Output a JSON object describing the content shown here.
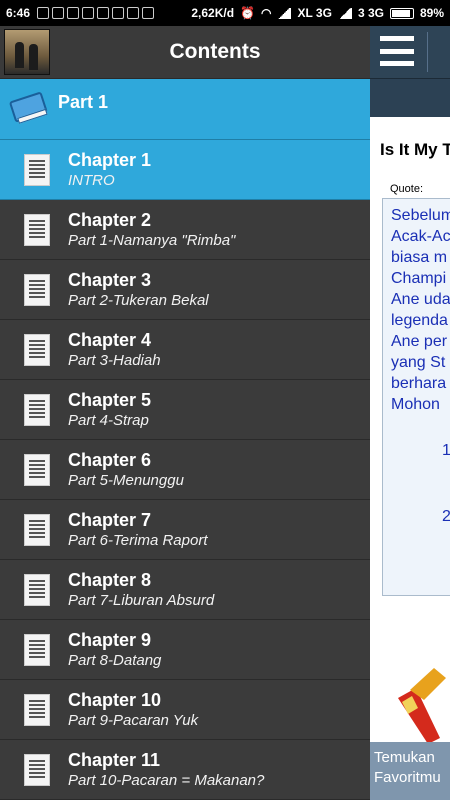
{
  "status_bar": {
    "time": "6:46",
    "speed": "2,62K/d",
    "network1": "XL 3G",
    "network2": "3 3G",
    "battery": "89%",
    "battery_level": 0.89,
    "icons": [
      "whatsapp-icon",
      "whatsapp-icon",
      "bbm-icon",
      "bbm-icon",
      "whatsapp-icon",
      "whatsapp-icon",
      "whatsapp-icon",
      "whatsapp-icon"
    ]
  },
  "drawer": {
    "title": "Contents",
    "part": {
      "label": "Part 1",
      "icon": "book-icon"
    },
    "chapters": [
      {
        "title": "Chapter 1",
        "subtitle": "INTRO",
        "active": true
      },
      {
        "title": "Chapter 2",
        "subtitle": "Part 1-Namanya \"Rimba\""
      },
      {
        "title": "Chapter 3",
        "subtitle": "Part 2-Tukeran Bekal"
      },
      {
        "title": "Chapter 4",
        "subtitle": "Part 3-Hadiah"
      },
      {
        "title": "Chapter 5",
        "subtitle": "Part 4-Strap"
      },
      {
        "title": "Chapter 6",
        "subtitle": "Part 5-Menunggu"
      },
      {
        "title": "Chapter 7",
        "subtitle": "Part 6-Terima Raport"
      },
      {
        "title": "Chapter 8",
        "subtitle": "Part 7-Liburan Absurd"
      },
      {
        "title": "Chapter 9",
        "subtitle": "Part 8-Datang"
      },
      {
        "title": "Chapter 10",
        "subtitle": "Part 9-Pacaran Yuk"
      },
      {
        "title": "Chapter 11",
        "subtitle": "Part 10-Pacaran = Makanan?"
      }
    ]
  },
  "content": {
    "article_title": "Is It My T",
    "quote_label": "Quote:",
    "quote_lines": [
      "Sebelum",
      "Acak-Ac",
      "biasa m",
      "Champi",
      "Ane uda",
      "legenda",
      "Ane per",
      "yang St",
      "berhara",
      "Mohon"
    ],
    "numbers": [
      "1",
      "2"
    ],
    "bottom_text": [
      "Temukan",
      "Favoritmu"
    ]
  },
  "colors": {
    "accent": "#2fa8db",
    "drawer_bg": "#3b3b3b",
    "toolbar": "#2e4456",
    "quote_text": "#1a2fb5"
  }
}
